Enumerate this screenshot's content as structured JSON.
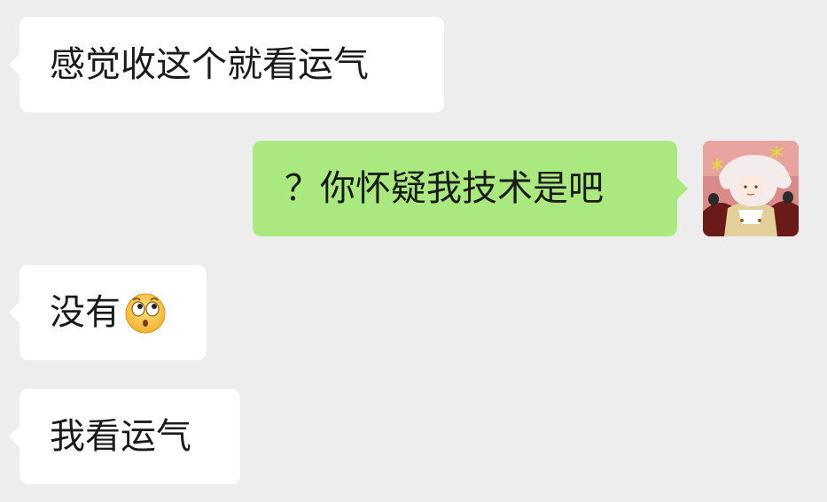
{
  "conversation": {
    "messages": [
      {
        "direction": "incoming",
        "text": "感觉收这个就看运气"
      },
      {
        "direction": "outgoing",
        "text": "？你怀疑我技术是吧"
      },
      {
        "direction": "incoming",
        "text": "没有",
        "emoji": "flushed-eyes-emoji"
      },
      {
        "direction": "incoming",
        "text": "我看运气"
      }
    ],
    "self_avatar": "anime-character-avatar"
  },
  "colors": {
    "background": "#ededed",
    "incoming_bubble": "#ffffff",
    "outgoing_bubble": "#a9e97f"
  }
}
